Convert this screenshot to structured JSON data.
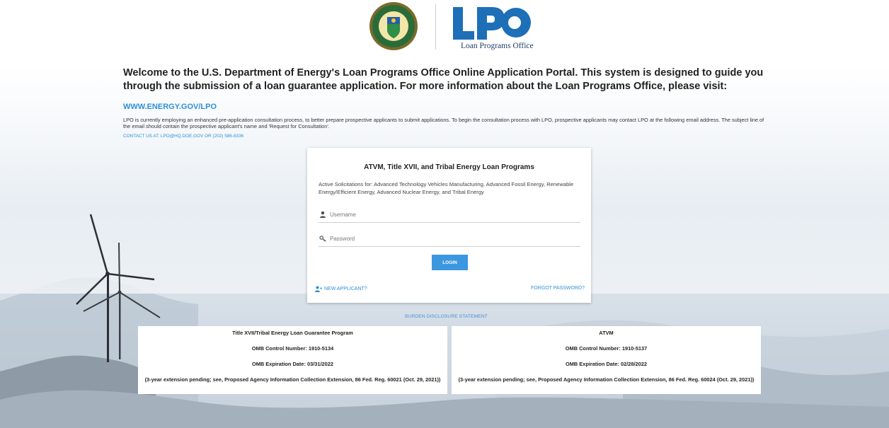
{
  "header": {
    "logo_text": "LPO",
    "logo_subtitle": "Loan Programs Office",
    "seal_text": "DEPARTMENT OF ENERGY · UNITED STATES OF AMERICA"
  },
  "intro": {
    "welcome": "Welcome to the U.S. Department of Energy's Loan Programs Office Online Application Portal. This system is designed to guide you through the submission of a loan guarantee application. For more information about the Loan Programs Office, please visit:",
    "site_link": "WWW.ENERGY.GOV/LPO",
    "consult": "LPO is currently employing an enhanced pre-application consultation process, to better prepare prospective applicants to submit applications. To begin the consultation process with LPO, prospective applicants may contact LPO at the following email address. The subject line of the email should contain the prospective applicant's name and 'Request for Consultation'.",
    "contact": "CONTACT US AT: LPO@HQ.DOE.GOV OR (202) 586-8336"
  },
  "login": {
    "title": "ATVM, Title XVII, and Tribal Energy Loan Programs",
    "description": "Active Solicitations for: Advanced Technology Vehicles Manufacturing, Advanced Fossil Energy, Renewable Energy/Efficient Energy, Advanced Nuclear Energy, and Tribal Energy",
    "username_placeholder": "Username",
    "password_placeholder": "Password",
    "login_label": "LOGIN",
    "new_applicant": "NEW APPLICANT?",
    "forgot_password": "FORGOT PASSWORD?"
  },
  "burden_link": "BURDEN DISCLOSURE STATEMENT",
  "omb_boxes": [
    {
      "title": "Title XVII/Tribal Energy Loan Guarantee Program",
      "control": "OMB Control Number: 1910-5134",
      "expiration": "OMB Expiration Date: 03/31/2022",
      "extension": "(3-year extension pending; see, Proposed Agency Information Collection Extension, 86 Fed. Reg. 60021 (Oct. 29, 2021))"
    },
    {
      "title": "ATVM",
      "control": "OMB Control Number: 1910-5137",
      "expiration": "OMB Expiration Date: 02/28/2022",
      "extension": "(3-year extension pending; see, Proposed Agency Information Collection Extension, 86 Fed. Reg. 60024 (Oct. 29, 2021))"
    }
  ],
  "colors": {
    "link": "#2f8fd8",
    "button": "#3b97e0",
    "logo_blue": "#1d6fb8"
  }
}
